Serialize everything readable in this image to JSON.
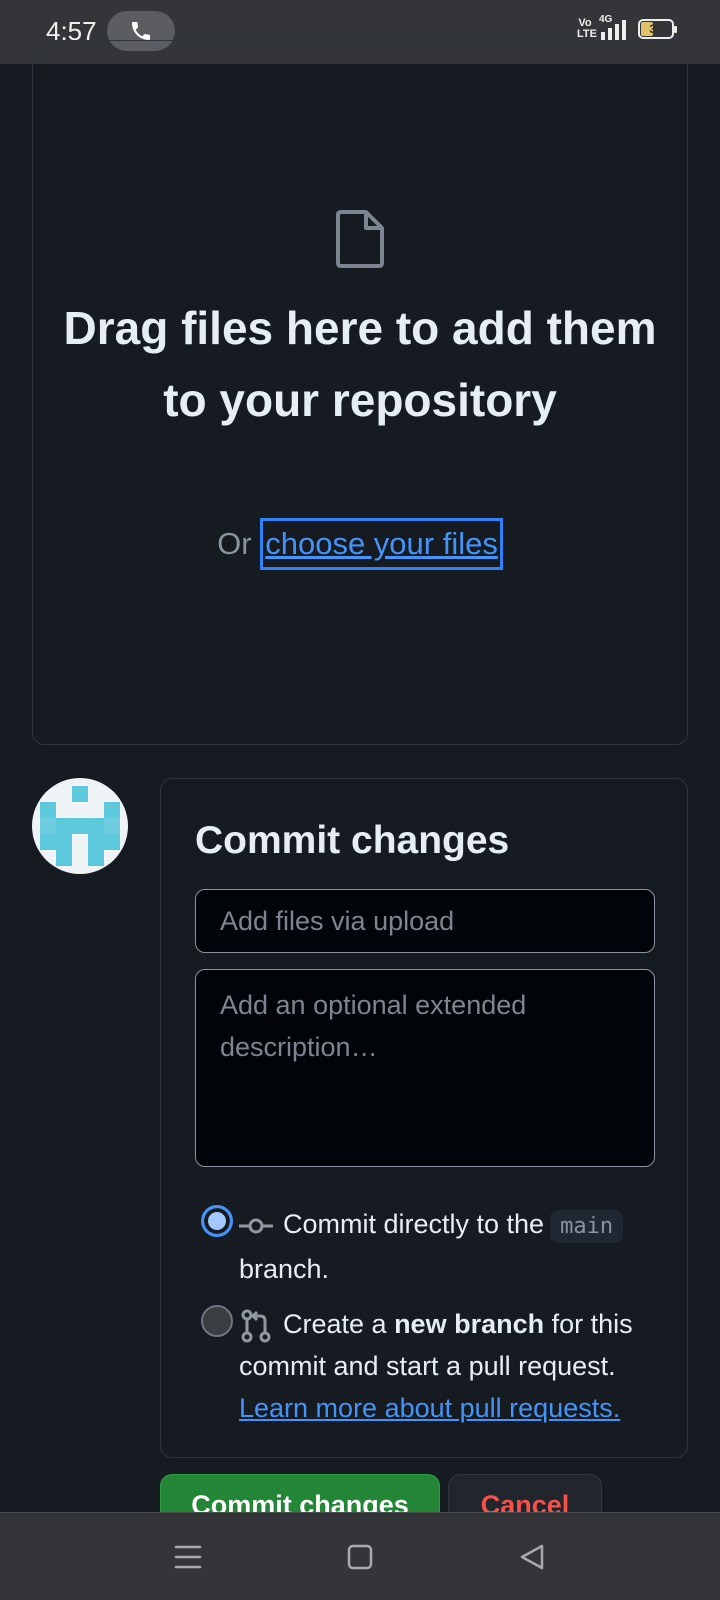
{
  "status_bar": {
    "time": "4:57",
    "volte": "Vo LTE",
    "network": "4G",
    "battery": "38",
    "battery_level": 0.38
  },
  "dropzone": {
    "icon": "file-icon",
    "title": "Drag files here to add them to your repository",
    "or_text": "Or ",
    "choose_link": "choose your files"
  },
  "commit": {
    "title": "Commit changes",
    "summary_placeholder": "Add files via upload",
    "description_placeholder": "Add an optional extended description…",
    "option_direct": {
      "text_before": "Commit directly to the",
      "branch": "main",
      "text_after": "branch.",
      "selected": true,
      "icon": "git-commit-icon"
    },
    "option_new_branch": {
      "text_before": "Create a ",
      "bold": "new branch",
      "text_after": " for this commit and start a pull request.",
      "link": "Learn more about pull requests.",
      "selected": false,
      "icon": "git-pull-request-icon"
    }
  },
  "actions": {
    "commit_label": "Commit changes",
    "cancel_label": "Cancel"
  },
  "colors": {
    "background": "#161b22",
    "primary_button": "#238636",
    "link": "#4493f8",
    "danger": "#f85149"
  }
}
